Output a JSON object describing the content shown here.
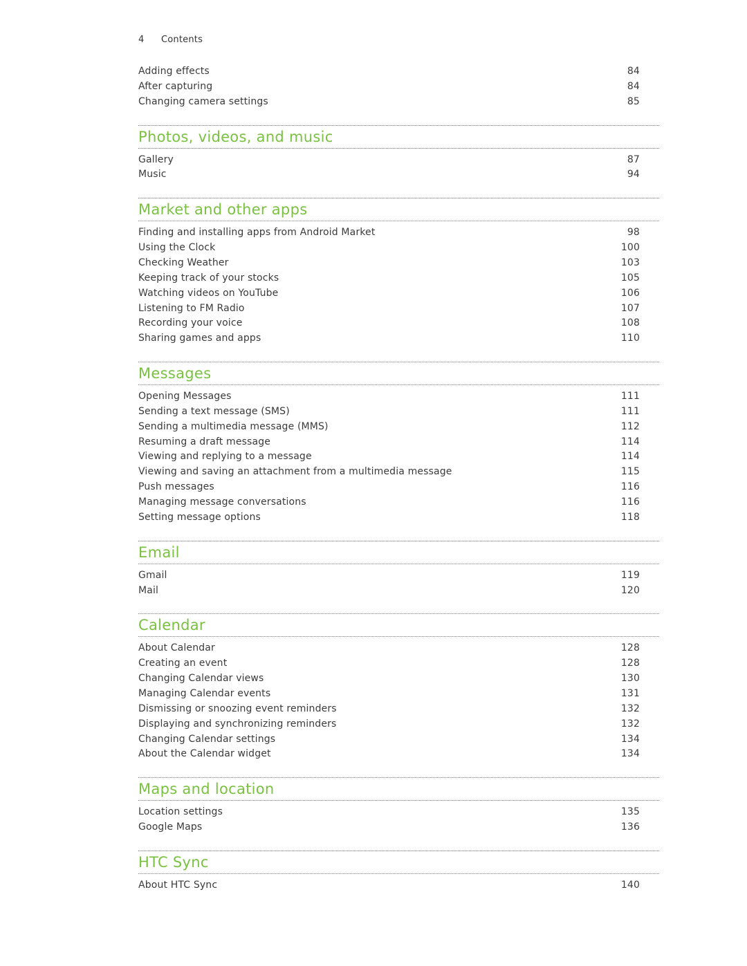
{
  "header": {
    "page_number": "4",
    "title": "Contents"
  },
  "accent_color": "#7ac142",
  "intro_entries": [
    {
      "title": "Adding effects",
      "page": "84"
    },
    {
      "title": "After capturing",
      "page": "84"
    },
    {
      "title": "Changing camera settings",
      "page": "85"
    }
  ],
  "sections": [
    {
      "title": "Photos, videos, and music",
      "entries": [
        {
          "title": "Gallery",
          "page": "87"
        },
        {
          "title": "Music",
          "page": "94"
        }
      ]
    },
    {
      "title": "Market and other apps",
      "entries": [
        {
          "title": "Finding and installing apps from Android Market",
          "page": "98"
        },
        {
          "title": "Using the Clock",
          "page": "100"
        },
        {
          "title": "Checking Weather",
          "page": "103"
        },
        {
          "title": "Keeping track of your stocks",
          "page": "105"
        },
        {
          "title": "Watching videos on YouTube",
          "page": "106"
        },
        {
          "title": "Listening to FM Radio",
          "page": "107"
        },
        {
          "title": "Recording your voice",
          "page": "108"
        },
        {
          "title": "Sharing games and apps",
          "page": "110"
        }
      ]
    },
    {
      "title": "Messages",
      "entries": [
        {
          "title": "Opening Messages",
          "page": "111"
        },
        {
          "title": "Sending a text message (SMS)",
          "page": "111"
        },
        {
          "title": "Sending a multimedia message (MMS)",
          "page": "112"
        },
        {
          "title": "Resuming a draft message",
          "page": "114"
        },
        {
          "title": "Viewing and replying to a message",
          "page": "114"
        },
        {
          "title": "Viewing and saving an attachment from a multimedia message",
          "page": "115"
        },
        {
          "title": "Push messages",
          "page": "116"
        },
        {
          "title": "Managing message conversations",
          "page": "116"
        },
        {
          "title": "Setting message options",
          "page": "118"
        }
      ]
    },
    {
      "title": "Email",
      "entries": [
        {
          "title": "Gmail",
          "page": "119"
        },
        {
          "title": "Mail",
          "page": "120"
        }
      ]
    },
    {
      "title": "Calendar",
      "entries": [
        {
          "title": "About Calendar",
          "page": "128"
        },
        {
          "title": "Creating an event",
          "page": "128"
        },
        {
          "title": "Changing Calendar views",
          "page": "130"
        },
        {
          "title": "Managing Calendar events",
          "page": "131"
        },
        {
          "title": "Dismissing or snoozing event reminders",
          "page": "132"
        },
        {
          "title": "Displaying and synchronizing reminders",
          "page": "132"
        },
        {
          "title": "Changing Calendar settings",
          "page": "134"
        },
        {
          "title": "About the Calendar widget",
          "page": "134"
        }
      ]
    },
    {
      "title": "Maps and location",
      "entries": [
        {
          "title": "Location settings",
          "page": "135"
        },
        {
          "title": "Google Maps",
          "page": "136"
        }
      ]
    },
    {
      "title": "HTC Sync",
      "entries": [
        {
          "title": "About HTC Sync",
          "page": "140"
        }
      ]
    }
  ]
}
